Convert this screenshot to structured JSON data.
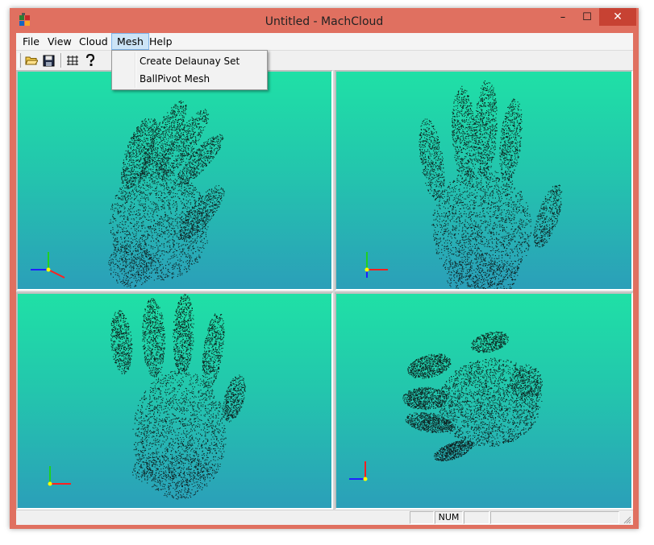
{
  "window": {
    "title": "Untitled - MachCloud",
    "controls": {
      "minimize": "–",
      "maximize": "☐",
      "close": "✕"
    }
  },
  "menubar": {
    "items": [
      {
        "label": "File"
      },
      {
        "label": "View"
      },
      {
        "label": "Cloud"
      },
      {
        "label": "Mesh",
        "active": true
      },
      {
        "label": "Help"
      }
    ]
  },
  "mesh_menu": {
    "items": [
      {
        "label": "Create Delaunay Set"
      },
      {
        "label": "BallPivot Mesh"
      }
    ]
  },
  "toolbar": {
    "buttons": [
      {
        "icon": "open-folder-icon"
      },
      {
        "icon": "save-disk-icon"
      },
      {
        "icon": "grid-cloud-icon"
      },
      {
        "icon": "help-question-icon"
      }
    ]
  },
  "viewports": [
    {
      "name": "perspective",
      "background_top": "#1fe0a6",
      "background_bottom": "#2b9fb9"
    },
    {
      "name": "front"
    },
    {
      "name": "back"
    },
    {
      "name": "top"
    }
  ],
  "axis_colors": {
    "x": "#ff2020",
    "y": "#20d020",
    "z": "#2020ff",
    "origin": "#ffff00"
  },
  "statusbar": {
    "panels": [
      "",
      "NUM",
      "",
      ""
    ]
  },
  "colors": {
    "frame": "#e07060",
    "close_button": "#c74233",
    "menu_highlight": "#cce4f7",
    "point_cloud": "#0a0a0a"
  }
}
